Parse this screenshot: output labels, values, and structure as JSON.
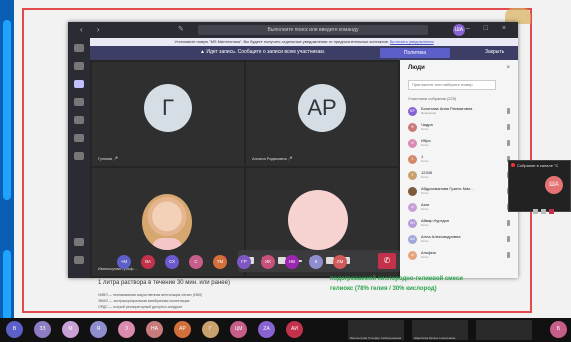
{
  "window": {
    "search_text": "Выполните поиск или введите команду",
    "me_initials": "ША"
  },
  "notice": {
    "text": "Установите новую \"MS Минтехника\". Вы будете получать отдельные уведомления от предпочтительных контактов.",
    "link": "Включить уведомления"
  },
  "recording": {
    "text": "Идет запись. Сообщите о записи всем участникам.",
    "privacy_button": "Политика конфиденциальности",
    "close_button": "Закрыть"
  },
  "stage": {
    "tiles": [
      {
        "initials": "Г",
        "name": "Гулюми"
      },
      {
        "initials": "АР",
        "name": "Алсина Радиковна"
      },
      {
        "initials": "",
        "name": "Имильсуова Гульф..."
      },
      {
        "initials": "",
        "name": "Шарипова Ирина А..."
      }
    ],
    "timer": "1"
  },
  "people": {
    "title": "Люди",
    "invite_placeholder": "Пригласите или наберите номер",
    "section": "Участники собрания (229)",
    "list": [
      {
        "initials": "БР",
        "name": "Болитова Ания Рахматовна",
        "role": "Инициатор",
        "color": "#8a63d2"
      },
      {
        "initials": "Ф",
        "name": "Чадра",
        "role": "Гость",
        "color": "#c97b7b"
      },
      {
        "initials": "И",
        "name": "Ибря",
        "role": "Гость",
        "color": "#d98bb0"
      },
      {
        "initials": "1",
        "name": "1",
        "role": "Гость",
        "color": "#d28a6b"
      },
      {
        "initials": "1",
        "name": "12345",
        "role": "Гость",
        "color": "#caa06f"
      },
      {
        "initials": "",
        "name": "Абдрахманова Гузель Мах...",
        "role": "Гость",
        "color": "#7d5a3c"
      },
      {
        "initials": "А",
        "name": "Азат",
        "role": "Гость",
        "color": "#c8a0d6"
      },
      {
        "initials": "АН",
        "name": "Айвар Нуртдин",
        "role": "Гость",
        "color": "#b39ddb"
      },
      {
        "initials": "АА",
        "name": "Алла Александровна",
        "role": "Гость",
        "color": "#9fa8da"
      },
      {
        "initials": "А",
        "name": "Альфия",
        "role": "Гость",
        "color": "#e6a57e"
      }
    ]
  },
  "bubbles": [
    {
      "t": "+M",
      "c": "#5b5fc7"
    },
    {
      "t": "ВА",
      "c": "#c4314b"
    },
    {
      "t": "СХ",
      "c": "#6a5acd"
    },
    {
      "t": "С",
      "c": "#c75d8a"
    },
    {
      "t": "ТМ",
      "c": "#d36f3a"
    },
    {
      "t": "ГР",
      "c": "#7e57c2"
    },
    {
      "t": "ИК",
      "c": "#c94f7c"
    },
    {
      "t": "НВ",
      "c": "#9c27b0"
    },
    {
      "t": "К",
      "c": "#8e8ecf"
    },
    {
      "t": "ЛМ",
      "c": "#d15a5a"
    }
  ],
  "slide": {
    "text_left": "1 литра раствора в течение 30 мин. или ранее)",
    "text_right_1": "подогреваемой кислородно-гелиевой смеси",
    "text_right_2": "гелиокс (78% гелия / 30% кислород)",
    "footnotes": [
      "НИВЛ — неинвазивная искусственная вентиляция легких (НВЛ)",
      "ЭКМО — экстракорпоральная мембранная оксигенация",
      "ОРДС — острый респираторный дистресс-синдром"
    ]
  },
  "mini_window": {
    "title": "Собрание в канале \"С",
    "initials": "ША"
  },
  "strip": [
    {
      "t": "В",
      "c": "#5b5fc7"
    },
    {
      "t": "ЗЗ",
      "c": "#8e7cc3"
    },
    {
      "t": "М",
      "c": "#c8a0d6"
    },
    {
      "t": "Я",
      "c": "#8e8ecf"
    },
    {
      "t": "З",
      "c": "#d98bb0"
    },
    {
      "t": "НА",
      "c": "#c97b7b"
    },
    {
      "t": "АР",
      "c": "#d36f3a"
    },
    {
      "t": "Г",
      "c": "#caa06f"
    },
    {
      "t": "ЦМ",
      "c": "#c75d8a"
    },
    {
      "t": "ZA",
      "c": "#8a63d2"
    },
    {
      "t": "АИ",
      "c": "#c4314b"
    }
  ],
  "strip_cams": [
    {
      "name": "Имильсуова Гульфир Сабирьяновна"
    },
    {
      "name": "Шарипова Ирина Алексеевна"
    },
    {
      "name": ""
    }
  ],
  "strip_end": "Б"
}
